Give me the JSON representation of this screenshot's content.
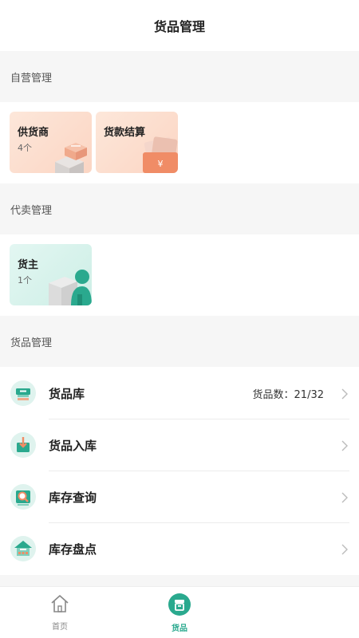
{
  "header": {
    "title": "货品管理"
  },
  "sections": {
    "self_operated": {
      "title": "自营管理"
    },
    "consignment": {
      "title": "代卖管理"
    },
    "goods": {
      "title": "货品管理"
    }
  },
  "cards": {
    "supplier": {
      "title": "供货商",
      "count": "4个"
    },
    "settlement": {
      "title": "货款结算"
    },
    "owner": {
      "title": "货主",
      "count": "1个"
    }
  },
  "list": [
    {
      "label": "货品库",
      "value": "货品数：21/32",
      "icon": "goods-library-icon"
    },
    {
      "label": "货品入库",
      "icon": "goods-inbound-icon"
    },
    {
      "label": "库存查询",
      "icon": "inventory-query-icon"
    },
    {
      "label": "库存盘点",
      "icon": "inventory-check-icon"
    }
  ],
  "tabbar": {
    "home": {
      "label": "首页",
      "icon": "home-icon"
    },
    "goods": {
      "label": "货品",
      "icon": "goods-icon",
      "active": true
    }
  },
  "colors": {
    "accent": "#2aa98e",
    "section_bg": "#f6f6f6",
    "orange_card": "#fbd5c3",
    "green_card": "#cdeee6"
  }
}
